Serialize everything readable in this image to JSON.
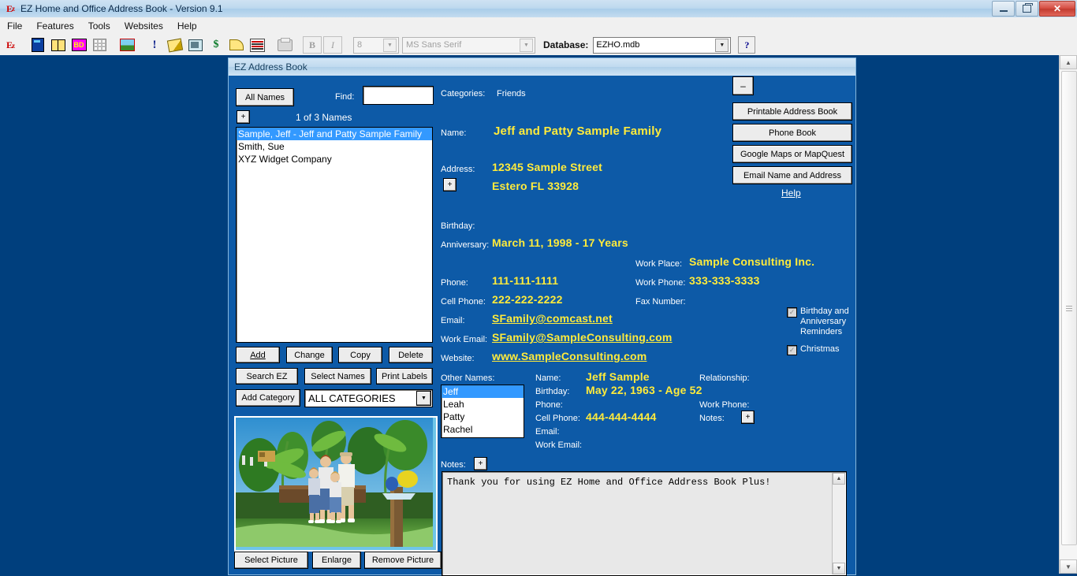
{
  "window": {
    "title": "EZ Home and Office Address Book - Version 9.1",
    "app_icon": "ez-icon",
    "ghost_text": "",
    "minimize": "—",
    "maximize": "❐",
    "close": "✕"
  },
  "menu": {
    "items": [
      "File",
      "Features",
      "Tools",
      "Websites",
      "Help"
    ]
  },
  "toolbar": {
    "icons": [
      {
        "name": "ez-logo-icon",
        "label": "EZ"
      },
      {
        "name": "address-book-icon",
        "label": ""
      },
      {
        "name": "open-book-icon",
        "label": ""
      },
      {
        "name": "birthday-icon",
        "label": "BD"
      },
      {
        "name": "grid-icon",
        "label": ""
      },
      {
        "name": "picture-icon",
        "label": ""
      },
      {
        "name": "reminder-icon",
        "label": "!"
      },
      {
        "name": "pencil-icon",
        "label": ""
      },
      {
        "name": "email-icon",
        "label": ""
      },
      {
        "name": "money-icon",
        "label": "$"
      },
      {
        "name": "cheese-icon",
        "label": ""
      },
      {
        "name": "list-icon",
        "label": ""
      },
      {
        "name": "print-icon",
        "label": ""
      }
    ],
    "bold_label": "B",
    "italic_label": "I",
    "font_size": "8",
    "font_name": "MS Sans Serif",
    "database_label": "Database:",
    "database_value": "EZHO.mdb",
    "help_label": "?"
  },
  "mdi": {
    "title": "EZ Address Book",
    "minimize_label": "–"
  },
  "left_panel": {
    "all_names_button": "All Names",
    "find_label": "Find:",
    "find_value": "",
    "expand_button": "+",
    "count_text": "1 of 3 Names",
    "names": [
      {
        "label": "Sample, Jeff - Jeff and Patty Sample Family",
        "selected": true
      },
      {
        "label": "Smith, Sue",
        "selected": false
      },
      {
        "label": "XYZ Widget Company",
        "selected": false
      }
    ],
    "buttons_row1": [
      "Add",
      "Change",
      "Copy",
      "Delete"
    ],
    "buttons_row2": [
      "Search EZ",
      "Select Names",
      "Print Labels"
    ],
    "add_category_button": "Add Category",
    "category_value": "ALL CATEGORIES",
    "picture_buttons": [
      "Select Picture",
      "Enlarge",
      "Remove Picture"
    ]
  },
  "details": {
    "categories_label": "Categories:",
    "categories_value": "Friends",
    "name_label": "Name:",
    "name_value": "Jeff and Patty Sample Family",
    "address_label": "Address:",
    "address_line1": "12345 Sample Street",
    "address_line2": "Estero FL  33928",
    "address_plus": "+",
    "birthday_label": "Birthday:",
    "birthday_value": "",
    "anniversary_label": "Anniversary:",
    "anniversary_value": "March 11, 1998  -  17 Years",
    "workplace_label": "Work Place:",
    "workplace_value": "Sample Consulting Inc.",
    "phone_label": "Phone:",
    "phone_value": "111-111-1111",
    "workphone_label": "Work Phone:",
    "workphone_value": "333-333-3333",
    "cellphone_label": "Cell Phone:",
    "cellphone_value": "222-222-2222",
    "fax_label": "Fax Number:",
    "fax_value": "",
    "email_label": "Email:",
    "email_value": "SFamily@comcast.net",
    "workemail_label": "Work Email:",
    "workemail_value": "SFamily@SampleConsulting.com",
    "website_label": "Website:",
    "website_value": "www.SampleConsulting.com"
  },
  "right_buttons": {
    "items": [
      "Printable Address Book",
      "Phone Book",
      "Google Maps or MapQuest",
      "Email Name and Address"
    ],
    "help_link": "Help"
  },
  "checkboxes": [
    {
      "label": "Birthday and Anniversary Reminders",
      "checked": true
    },
    {
      "label": "Christmas",
      "checked": true
    }
  ],
  "other_names": {
    "section_label": "Other Names:",
    "list": [
      {
        "label": "Jeff",
        "selected": true
      },
      {
        "label": "Leah",
        "selected": false
      },
      {
        "label": "Patty",
        "selected": false
      },
      {
        "label": "Rachel",
        "selected": false
      }
    ],
    "name_label": "Name:",
    "name_value": "Jeff Sample",
    "birthday_label": "Birthday:",
    "birthday_value": "May 22, 1963 - Age 52",
    "phone_label": "Phone:",
    "phone_value": "",
    "cellphone_label": "Cell Phone:",
    "cellphone_value": "444-444-4444",
    "email_label": "Email:",
    "email_value": "",
    "workemail_label": "Work Email:",
    "workemail_value": "",
    "relationship_label": "Relationship:",
    "relationship_value": "",
    "workphone_label": "Work Phone:",
    "workphone_value": "",
    "notes_label": "Notes:",
    "notes_plus": "+"
  },
  "notes": {
    "label": "Notes:",
    "plus": "+",
    "text": "Thank you for using EZ Home and Office Address Book Plus!"
  },
  "colors": {
    "desktop": "#003f7d",
    "panel": "#0d5aa7",
    "value_text": "#ffeb3b",
    "label_text": "#ffffff",
    "selection": "#3399ff"
  }
}
